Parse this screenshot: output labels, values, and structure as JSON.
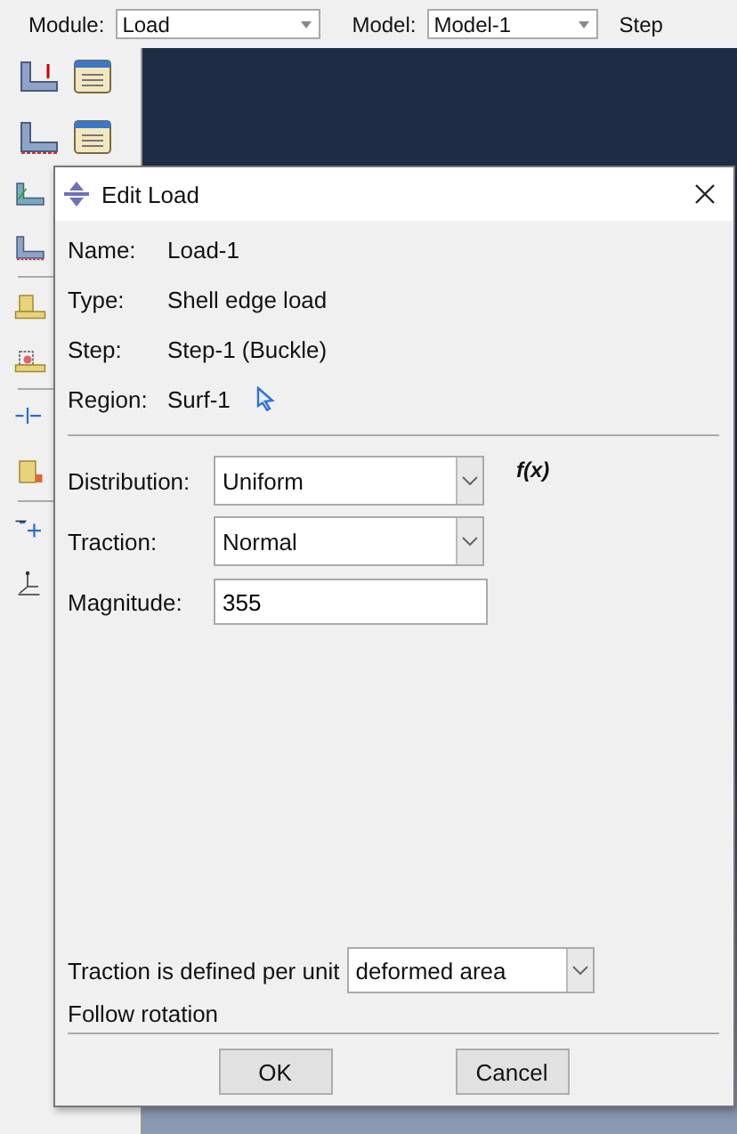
{
  "toolbar": {
    "module_label": "Module:",
    "module": "Load",
    "model_label": "Model:",
    "model": "Model-1",
    "step_label": "Step"
  },
  "dialog": {
    "title": "Edit Load",
    "info": [
      {
        "label": "Name:",
        "value": "Load-1",
        "kind": "text"
      },
      {
        "label": "Type:",
        "value": "Shell edge load",
        "kind": "text"
      },
      {
        "label": "Step:",
        "value": "Step-1 (Buckle)",
        "kind": "text"
      },
      {
        "label": "Region:",
        "value": "Surf-1",
        "kind": "region"
      }
    ],
    "fields": [
      {
        "kind": "dropdown",
        "label": "Distribution:",
        "value": "Uniform"
      },
      {
        "kind": "dropdown",
        "label": "Traction:",
        "value": "Normal"
      },
      {
        "kind": "input",
        "label": "Magnitude:",
        "value": "355"
      }
    ],
    "fx": "f(x)",
    "unit_label": "Traction is defined per unit",
    "unit_value": "deformed area",
    "follow_rotation": "Follow rotation",
    "buttons": [
      "OK",
      "Cancel"
    ]
  }
}
